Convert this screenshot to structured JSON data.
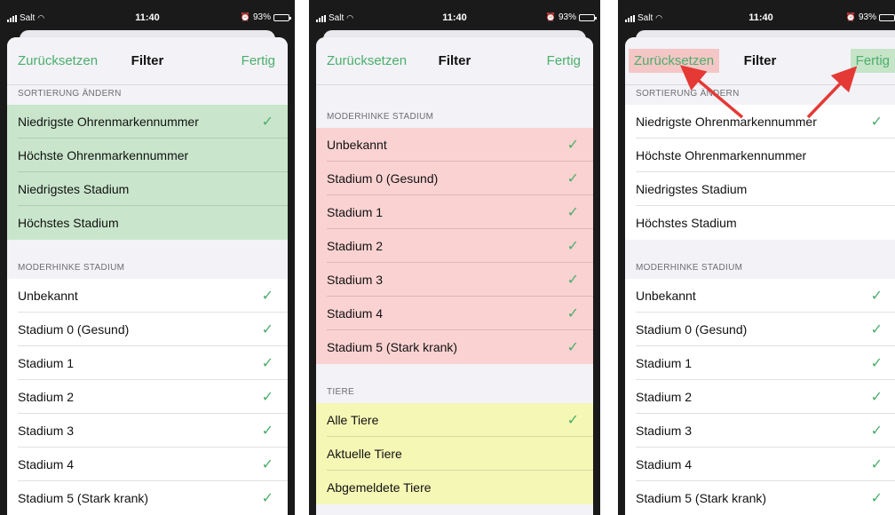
{
  "status": {
    "carrier": "Salt",
    "time": "11:40",
    "battery": "93%"
  },
  "nav": {
    "left": "Zurücksetzen",
    "title": "Filter",
    "right": "Fertig"
  },
  "sections": {
    "sort": "SORTIERUNG ÄNDERN",
    "stage": "MODERHINKE STADIUM",
    "animals": "TIERE"
  },
  "sort_items": [
    {
      "label": "Niedrigste Ohrenmarkennummer",
      "checked": true
    },
    {
      "label": "Höchste Ohrenmarkennummer",
      "checked": false
    },
    {
      "label": "Niedrigstes Stadium",
      "checked": false
    },
    {
      "label": "Höchstes Stadium",
      "checked": false
    }
  ],
  "stage_items": [
    {
      "label": "Unbekannt",
      "checked": true
    },
    {
      "label": "Stadium 0 (Gesund)",
      "checked": true
    },
    {
      "label": "Stadium 1",
      "checked": true
    },
    {
      "label": "Stadium 2",
      "checked": true
    },
    {
      "label": "Stadium 3",
      "checked": true
    },
    {
      "label": "Stadium 4",
      "checked": true
    },
    {
      "label": "Stadium 5 (Stark krank)",
      "checked": true
    }
  ],
  "animal_items": [
    {
      "label": "Alle Tiere",
      "checked": true
    },
    {
      "label": "Aktuelle Tiere",
      "checked": false
    },
    {
      "label": "Abgemeldete Tiere",
      "checked": false
    }
  ],
  "colors": {
    "accent": "#4cae6a",
    "highlight_green": "#c9e6cc",
    "highlight_red": "#fbd2d2",
    "highlight_yellow": "#f5f7b5",
    "arrow": "#e53935"
  },
  "icons": [
    "signal-bars-icon",
    "wifi-icon",
    "alarm-icon",
    "battery-icon",
    "checkmark-icon",
    "arrow-icon"
  ]
}
